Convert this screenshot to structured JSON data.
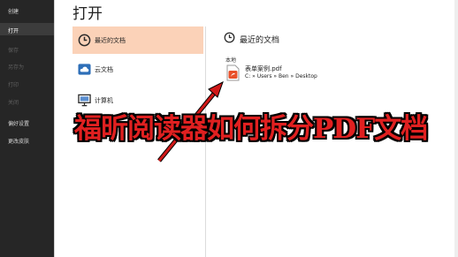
{
  "sidebar": {
    "items": [
      {
        "label": "创建",
        "state": "normal"
      },
      {
        "label": "打开",
        "state": "active"
      },
      {
        "label": "保存",
        "state": "disabled"
      },
      {
        "label": "另存为",
        "state": "disabled"
      },
      {
        "label": "打印",
        "state": "disabled"
      },
      {
        "label": "关闭",
        "state": "disabled"
      },
      {
        "label": "偏好设置",
        "state": "normal"
      },
      {
        "label": "更改皮肤",
        "state": "normal"
      }
    ]
  },
  "main": {
    "title": "打开",
    "places": [
      {
        "label": "最近的文档",
        "icon": "clock-icon",
        "selected": true
      },
      {
        "label": "云文档",
        "icon": "cloud-icon",
        "selected": false
      },
      {
        "label": "计算机",
        "icon": "computer-icon",
        "selected": false
      }
    ],
    "recent": {
      "heading": "最近的文档",
      "section_label": "本地",
      "files": [
        {
          "name": "表单案例.pdf",
          "path": "C: » Users » Ben » Desktop",
          "icon": "pdf-file-icon"
        }
      ]
    }
  },
  "overlay": {
    "caption": "福昕阅读器如何拆分PDF文档",
    "color": "#e02020"
  },
  "colors": {
    "sidebar_bg": "#262626",
    "selected_bg": "#fbd2b8",
    "pdf_accent": "#e8502a"
  }
}
